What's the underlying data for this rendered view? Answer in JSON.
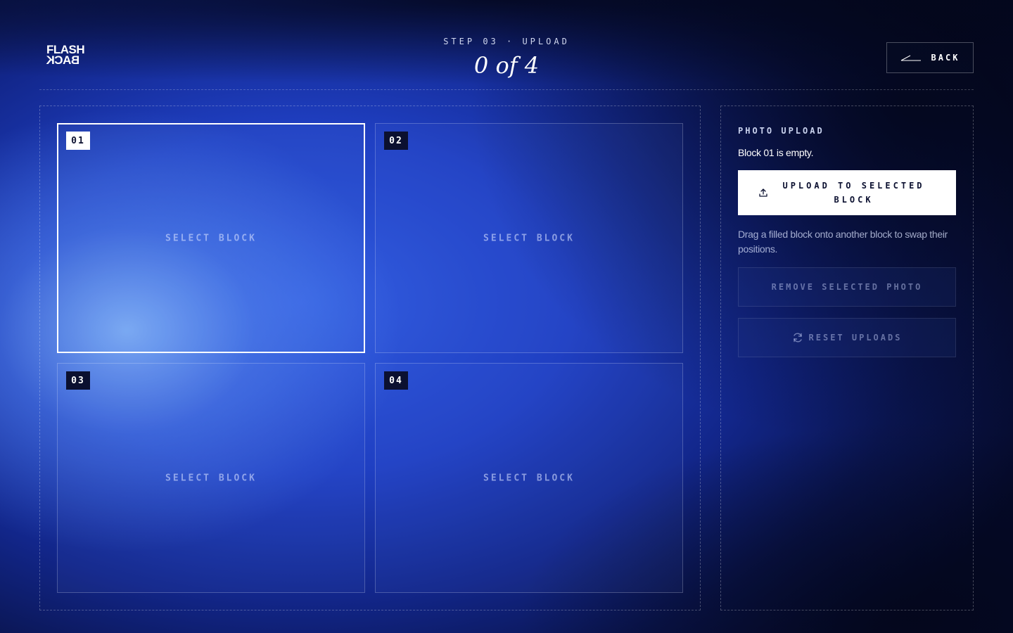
{
  "header": {
    "logo_top": "FLASH",
    "logo_bottom": "BACK",
    "step_label": "STEP 03 · UPLOAD",
    "counter": "0 of 4",
    "back_label": "BACK"
  },
  "grid": {
    "blocks": [
      {
        "number": "01",
        "label": "SELECT BLOCK",
        "selected": true
      },
      {
        "number": "02",
        "label": "SELECT BLOCK",
        "selected": false
      },
      {
        "number": "03",
        "label": "SELECT BLOCK",
        "selected": false
      },
      {
        "number": "04",
        "label": "SELECT BLOCK",
        "selected": false
      }
    ]
  },
  "panel": {
    "title": "PHOTO UPLOAD",
    "status": "Block 01 is empty.",
    "upload_label": "UPLOAD TO SELECTED BLOCK",
    "hint": "Drag a filled block onto another block to swap their positions.",
    "remove_label": "REMOVE SELECTED PHOTO",
    "reset_label": "RESET UPLOADS"
  },
  "icons": {
    "back": "arrow-left-icon",
    "upload": "upload-icon",
    "reset": "refresh-icon"
  }
}
